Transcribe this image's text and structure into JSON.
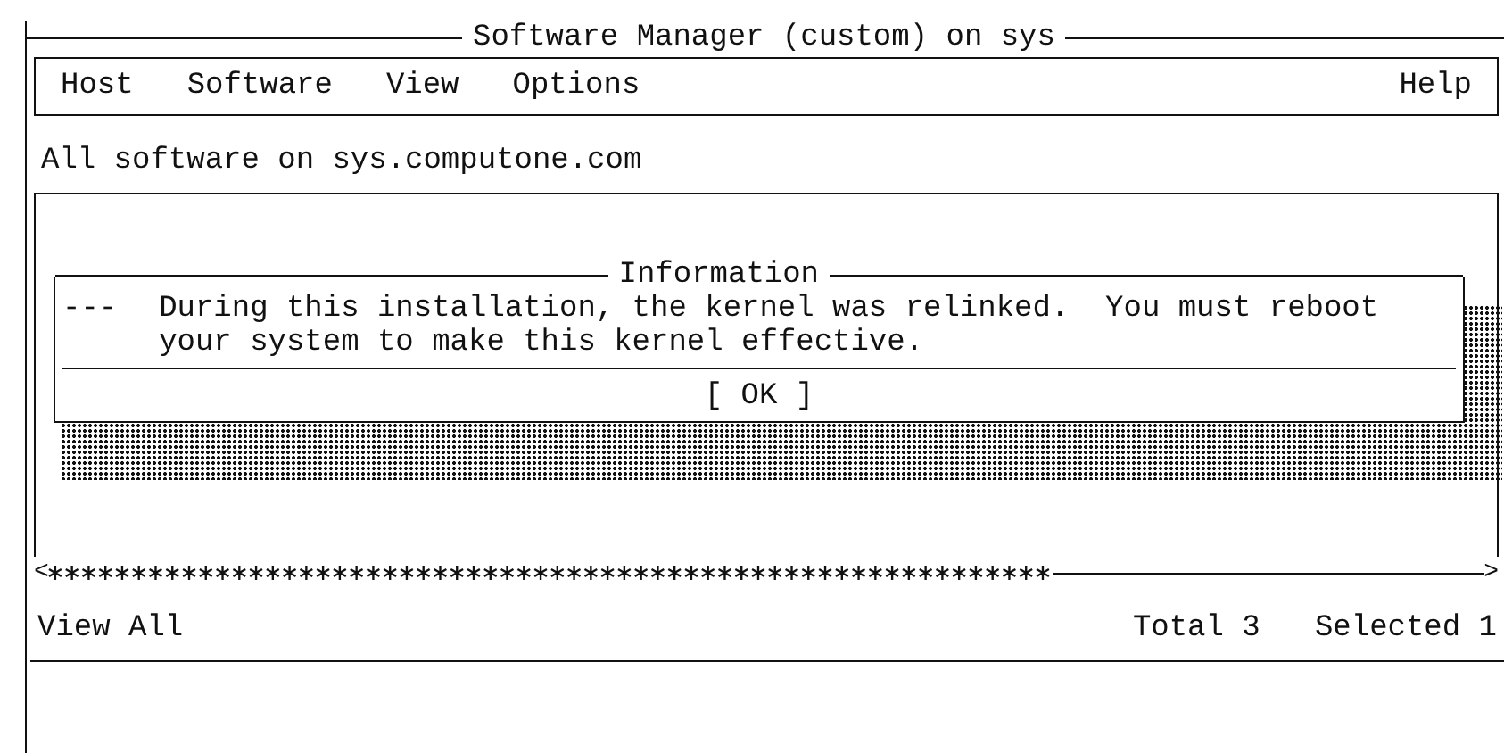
{
  "window": {
    "title": "Software Manager (custom) on sys"
  },
  "menu": {
    "items": [
      "Host",
      "Software",
      "View",
      "Options"
    ],
    "help": "Help"
  },
  "heading": "All software on sys.computone.com",
  "dialog": {
    "title": "Information",
    "marker": "---",
    "message": "During this installation, the kernel was relinked.  You must reboot your system to make this kernel effective.",
    "buttons": [
      "[ OK ]"
    ]
  },
  "scrollbar": {
    "left": "<",
    "right": ">"
  },
  "status": {
    "view": "View All",
    "total": "Total 3",
    "selected": "Selected 1"
  }
}
